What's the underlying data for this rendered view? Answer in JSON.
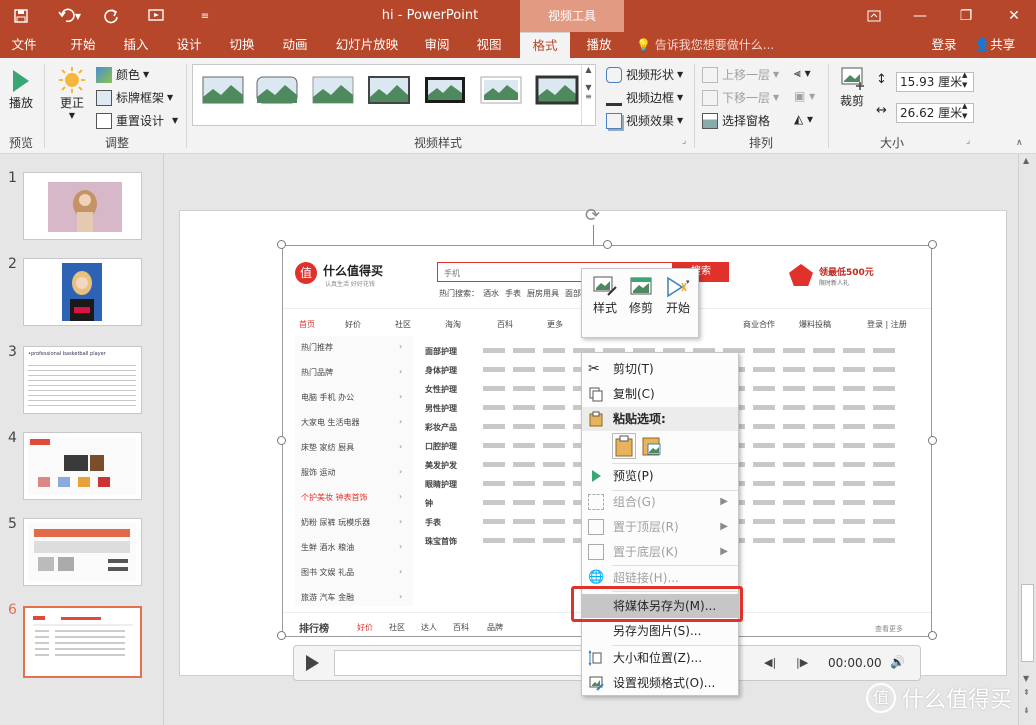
{
  "titlebar": {
    "title": "hi  -  PowerPoint",
    "context_group": "视频工具"
  },
  "menu": {
    "tabs": [
      "文件",
      "开始",
      "插入",
      "设计",
      "切换",
      "动画",
      "幻灯片放映",
      "审阅",
      "视图",
      "格式",
      "播放"
    ],
    "active_tab": "格式",
    "tell_me": "告诉我您想要做什么...",
    "login": "登录",
    "share": "共享"
  },
  "ribbon": {
    "preview": {
      "play": "播放",
      "label": "预览"
    },
    "adjust": {
      "correct": "更正",
      "color": "颜色",
      "poster_frame": "标牌框架",
      "reset": "重置设计",
      "label": "调整"
    },
    "video_styles": {
      "shape": "视频形状",
      "border": "视频边框",
      "effects": "视频效果",
      "label": "视频样式"
    },
    "arrange": {
      "bring_forward": "上移一层",
      "send_backward": "下移一层",
      "selection_pane": "选择窗格",
      "label": "排列"
    },
    "size": {
      "crop": "裁剪",
      "height": "15.93 厘米",
      "width": "26.62 厘米",
      "label": "大小"
    }
  },
  "slides": {
    "numbers": [
      "1",
      "2",
      "3",
      "4",
      "5",
      "6"
    ],
    "active": "6",
    "slide3_text": "•professional basketball player"
  },
  "video_content": {
    "logo": "什么值得买",
    "logo_sub": "认真生活 好好花钱",
    "search_placeholder": "手机",
    "search_button": "搜索",
    "hot_label": "热门搜索：",
    "hot_terms": [
      "酒水",
      "手表",
      "厨房用具",
      "面部护理"
    ],
    "nav": [
      "首页",
      "好价",
      "社区",
      "海淘",
      "百科",
      "更多"
    ],
    "nav_right": [
      "商业合作",
      "爆料投稿",
      "登录 | 注册"
    ],
    "promo": "领最低500元",
    "promo_sub": "限时新人礼",
    "sidebar": [
      "热门推荐",
      "热门品牌",
      "电脑 手机 办公",
      "大家电 生活电器",
      "床垫 家纺 厨具",
      "服饰 运动",
      "个护美妆 钟表首饰",
      "奶粉 尿裤 玩模乐器",
      "生鲜 酒水 粮油",
      "图书 文娱 礼品",
      "旅游 汽车 金融"
    ],
    "categories": [
      "面部护理",
      "身体护理",
      "女性护理",
      "男性护理",
      "彩妆产品",
      "口腔护理",
      "美发护发",
      "眼睛护理",
      "钟",
      "手表",
      "珠宝首饰"
    ],
    "bottom_bar": [
      "排行榜",
      "好价",
      "社区",
      "达人",
      "百科",
      "品牌"
    ],
    "more": "查看更多"
  },
  "video_controls": {
    "time": "00:00.00"
  },
  "mini_toolbar": {
    "style": "样式",
    "trim": "修剪",
    "start": "开始"
  },
  "context_menu": {
    "cut": "剪切(T)",
    "copy": "复制(C)",
    "paste_options": "粘贴选项:",
    "preview": "预览(P)",
    "group": "组合(G)",
    "bring_to_front": "置于顶层(R)",
    "send_to_back": "置于底层(K)",
    "hyperlink": "超链接(H)...",
    "save_media": "将媒体另存为(M)...",
    "save_picture": "另存为图片(S)...",
    "size_position": "大小和位置(Z)...",
    "format_video": "设置视频格式(O)..."
  },
  "watermark": "什么值得买",
  "colors": {
    "accent": "#b7472a",
    "highlight_box": "#e0312a"
  }
}
